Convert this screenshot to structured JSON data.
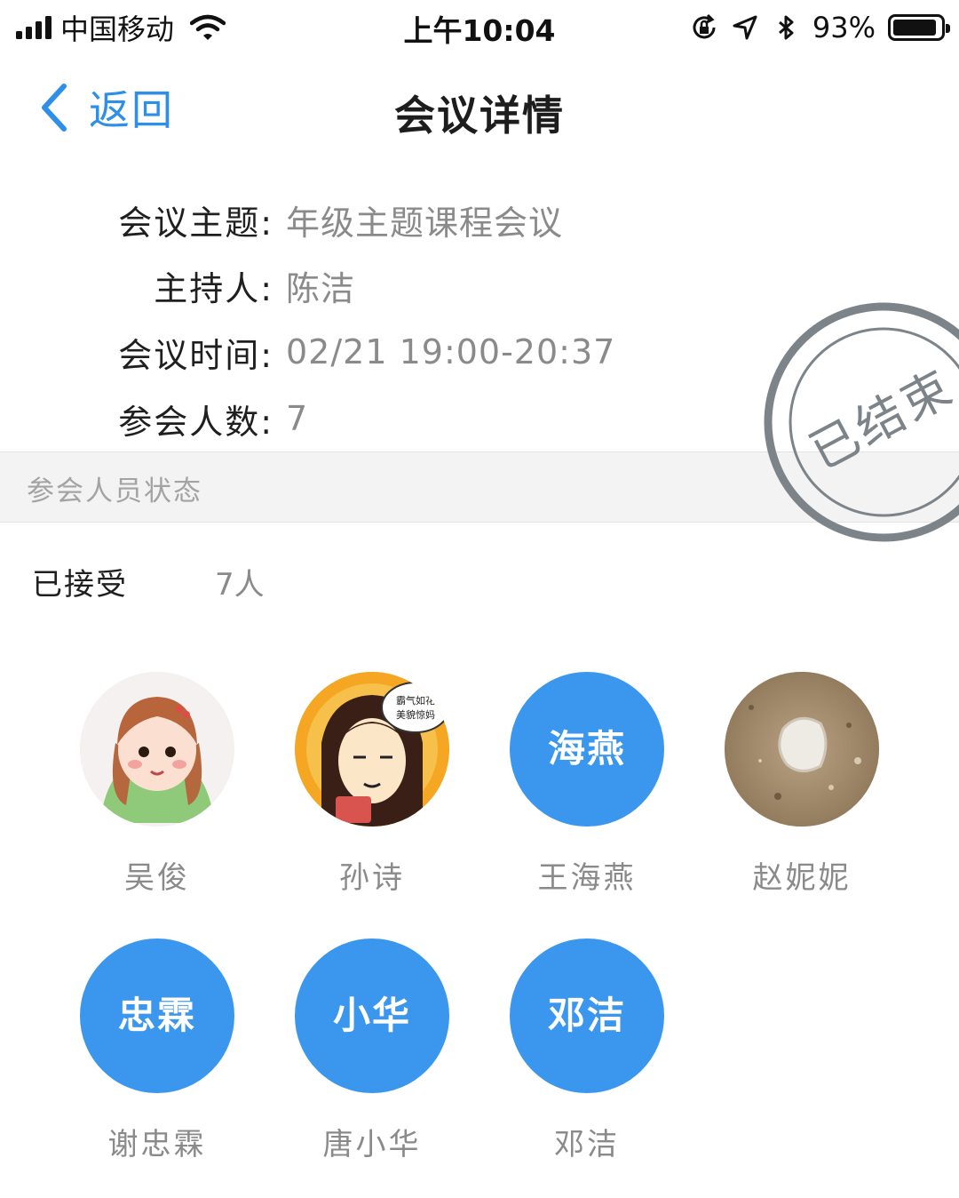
{
  "status_bar": {
    "carrier": "中国移动",
    "time": "上午10:04",
    "battery_percent": "93%",
    "battery_level": 0.93
  },
  "nav": {
    "back_label": "返回",
    "title": "会议详情"
  },
  "info": {
    "topic_label": "会议主题:",
    "topic_value": "年级主题课程会议",
    "host_label": "主持人:",
    "host_value": "陈洁",
    "time_label": "会议时间:",
    "time_value": "02/21 19:00-20:37",
    "count_label": "参会人数:",
    "count_value": "7"
  },
  "stamp": {
    "text": "已结束"
  },
  "section": {
    "title": "参会人员状态"
  },
  "accepted": {
    "label": "已接受",
    "count": "7人"
  },
  "participants": [
    {
      "name": "吴俊",
      "avatar_text": ""
    },
    {
      "name": "孙诗",
      "avatar_text": "",
      "speech_bubble_line1": "霸气如花",
      "speech_bubble_line2": "美貌惊妈"
    },
    {
      "name": "王海燕",
      "avatar_text": "海燕"
    },
    {
      "name": "赵妮妮",
      "avatar_text": ""
    },
    {
      "name": "谢忠霖",
      "avatar_text": "忠霖"
    },
    {
      "name": "唐小华",
      "avatar_text": "小华"
    },
    {
      "name": "邓洁",
      "avatar_text": "邓洁"
    }
  ],
  "colors": {
    "accent": "#2e8fe8",
    "avatar_bg": "#3b96ee",
    "stamp": "#7d8489",
    "section_bg": "#f3f3f3"
  }
}
